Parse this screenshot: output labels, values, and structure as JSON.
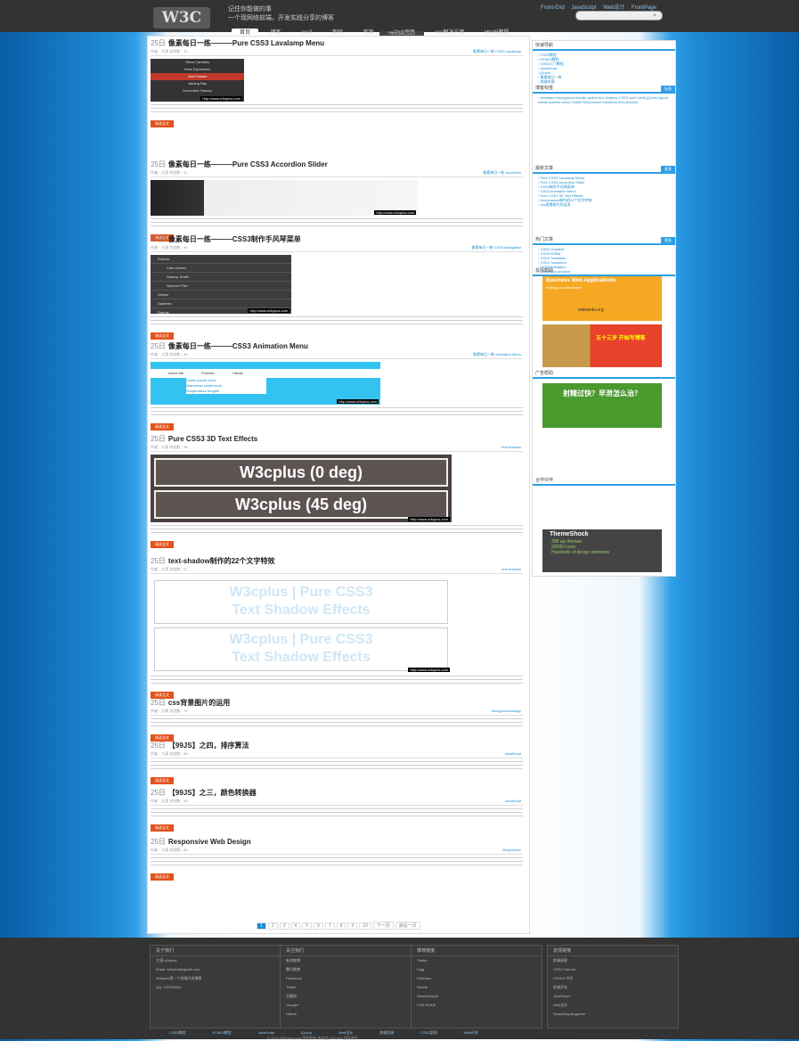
{
  "header": {
    "logo": "W3C",
    "slogan1": "记住你能做的事",
    "slogan2": "一个现网络前端，开发实践分享的博客",
    "toplinks": [
      "Front-End",
      "JavaScript",
      "Web设计",
      "FrontPage"
    ],
    "nav": [
      "首页",
      "博客",
      "css3",
      "案例",
      "资源",
      "Web项目",
      "css解决方案",
      "Html5教程"
    ],
    "subnav": "Html5&CSS3"
  },
  "posts": [
    {
      "date": "25日",
      "title": "像素每日一练———Pure CSS3 Lavalamp Menu",
      "meta": "作者：大漠  浏览数：32",
      "tags": "像素每日一练  CSS3  Lavalamp",
      "thumb": "lavalamp",
      "more": "阅读全文"
    },
    {
      "date": "25日",
      "title": "像素每日一练———Pure CSS3 Accordion Slider",
      "meta": "作者：大漠  浏览数：37",
      "tags": "像素每日一练  Accordion",
      "thumb": "accordion",
      "more": "阅读全文"
    },
    {
      "date": "25日",
      "title": "像素每日一练———CSS3制作手风琴菜单",
      "meta": "作者：大漠  浏览数：46",
      "tags": "像素每日一练  CSS3  Navigation",
      "thumb": "accmenu",
      "more": "阅读全文"
    },
    {
      "date": "25日",
      "title": "像素每日一练———CSS3 Animation Menu",
      "meta": "作者：大漠  浏览数：46",
      "tags": "像素每日一练  Animation  Menu",
      "thumb": "animmenu",
      "more": "阅读全文"
    },
    {
      "date": "25日",
      "title": "Pure CSS3 3D Text Effects",
      "meta": "作者：大漠  浏览数：58",
      "tags": "text-shadow",
      "thumb": "text3d",
      "more": "阅读全文"
    },
    {
      "date": "25日",
      "title": "text-shadow制作的22个文字特效",
      "meta": "作者：大漠  浏览数：67",
      "tags": "text-shadow",
      "thumb": "textshadow",
      "more": "阅读全文"
    },
    {
      "date": "25日",
      "title": "css背景图片的运用",
      "meta": "作者：大漠  浏览数：79",
      "tags": "background-image",
      "thumb": "",
      "more": "阅读全文"
    },
    {
      "date": "25日",
      "title": "【99JS】之四，排序算法",
      "meta": "作者：大漠  浏览数：58",
      "tags": "JavaScript",
      "thumb": "",
      "more": "阅读全文"
    },
    {
      "date": "25日",
      "title": "【99JS】之三，颜色转换器",
      "meta": "作者：大漠  浏览数：58",
      "tags": "JavaScript",
      "thumb": "",
      "more": "阅读全文"
    },
    {
      "date": "25日",
      "title": "Responsive Web Design",
      "meta": "作者：大漠  浏览数：66",
      "tags": "Responsive",
      "thumb": "",
      "more": "阅读全文"
    }
  ],
  "thumbs": {
    "lavalamp": [
      "Steve Careless",
      "Hack Expression",
      "Josh Smash",
      "Jaming Ray",
      "Document Factory"
    ],
    "accmenu": [
      "Friends",
      "Cato Galvez",
      "Sammy Smith",
      "Spencer Fish",
      "Videos",
      "Galleries",
      "Robots"
    ],
    "animmenu": [
      "About Me",
      "Portfolio",
      "Clients",
      "Lorem ipsum dolor",
      "Maecenas semin serio",
      "Suspendisse fringilla"
    ],
    "text3d": [
      "W3cplus (0 deg)",
      "W3cplus (45 deg)"
    ],
    "textshadow": [
      "W3cplus | Pure CSS3",
      "Text Shadow Effects",
      "W3cplus | Pure CSS3",
      "Text Shadow Effects"
    ],
    "watermark": "http://www.w3cplus.com"
  },
  "pager": [
    "1",
    "2",
    "3",
    "4",
    "5",
    "6",
    "7",
    "8",
    "9",
    "10",
    "下一页",
    "最后一页"
  ],
  "sidebar": {
    "widgets": [
      {
        "title": "快速导航",
        "mark": "",
        "items": [
          "CSS3教程",
          "HTML5教程",
          "CSS3入门教程",
          "JavaScript",
          "jQuery",
          "像素每日一练",
          "前端资源"
        ]
      },
      {
        "title": "博客标签",
        "mark": "标签",
        "items": [
          "animation background border-radius box-shadow CSS3 css3 html5 jQuery layout media queries menu mobile Responsive transform text-shadow"
        ]
      },
      {
        "title": "最新文章",
        "mark": "更多",
        "items": [
          "Pure CSS3 Lavalamp Menu",
          "Pure CSS3 Accordion Slider",
          "CSS3制作手风琴菜单",
          "CSS3 Animation Menu",
          "Pure CSS3 3D Text Effects",
          "text-shadow制作的22个文字特效",
          "css背景图片的运用"
        ]
      },
      {
        "title": "热门文章",
        "mark": "更多",
        "items": [
          "CSS3 Gradient",
          "CSS3 RGBA",
          "CSS3 Transition",
          "CSS3 Transform",
          "CSS3 Animation",
          "CSS3 Box-shadow"
        ]
      },
      {
        "title": "友情帮助",
        "mark": "",
        "items": []
      },
      {
        "title": "广告帮助",
        "mark": "",
        "items": []
      },
      {
        "title": "合作伙伴",
        "mark": "",
        "items": []
      }
    ],
    "ad1_title": "Business Web Applications",
    "ad1_sub": "nothing but JavaScript",
    "ad1_brand": "wakanda.org",
    "ad2_title": "五十三岁 开始写博客",
    "ad3_title": "射精过快？早泄怎么治？",
    "ad4_brand": "ThemeShock",
    "ad4_items": [
      "298 wp themes",
      "20000 icons",
      "Hundreds of design elements"
    ]
  },
  "footer": {
    "cols": [
      {
        "title": "关于我们",
        "items": [
          "大漠  w3cplus",
          "Email: w3cplus@gmail.com",
          "W3cplus是一个前端开发博客",
          "QQ: 120755423"
        ]
      },
      {
        "title": "关注我们",
        "items": [
          "新浪微博",
          "腾讯微博",
          "Facebook",
          "Twitter",
          "豆瓣网",
          "Google+",
          "Github"
        ]
      },
      {
        "title": "推荐链接",
        "items": [
          "Twitter",
          "Digg",
          "Delicious",
          "Reddit",
          "StumbleUpon",
          "CSS MODE"
        ]
      },
      {
        "title": "友情链接",
        "items": [
          "前端观察",
          "CSS3 Tutorial",
          "HTML5 中文",
          "前端开发",
          "JavaScript",
          "Web设计",
          "Smashing Magazine"
        ]
      }
    ],
    "links": [
      "CSS3教程",
      "HTML5教程",
      "JavaScript",
      "jQuery",
      "Web设计",
      "前端资源",
      "CSS3案例",
      "Web开发"
    ],
    "copyright": "© 2012 W3cplus.com 版权所有 本站由 W3cplus 团队维护"
  }
}
